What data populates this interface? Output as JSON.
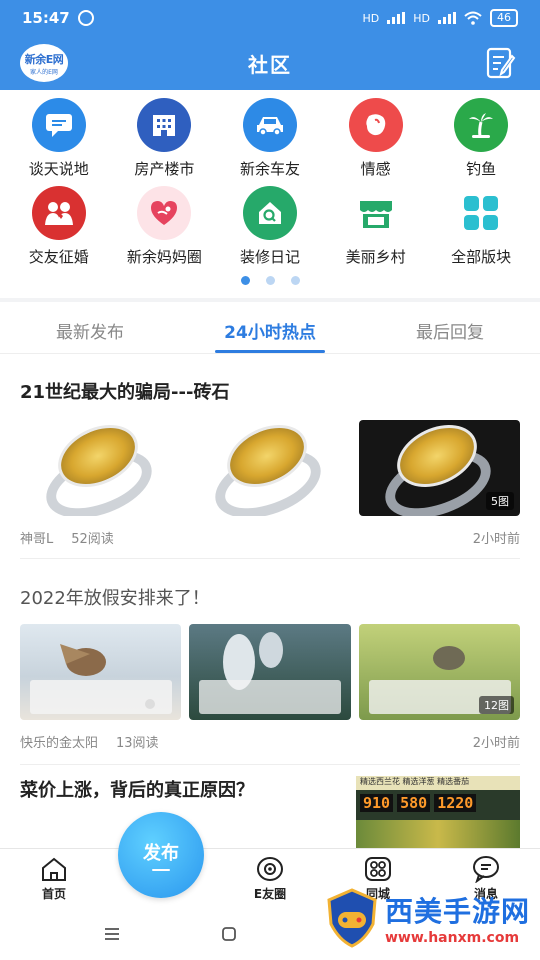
{
  "status_bar": {
    "time": "15:47",
    "battery": "46",
    "signal1": "HD",
    "signal2": "HD"
  },
  "header": {
    "title": "社区",
    "logo_text": "新余E网",
    "logo_sub": "家人的E网"
  },
  "categories_row1": [
    {
      "label": "谈天说地",
      "color": "#2c8be8",
      "icon": "chat-icon"
    },
    {
      "label": "房产楼市",
      "color": "#2f5fbf",
      "icon": "building-icon"
    },
    {
      "label": "新余车友",
      "color": "#2d8ae6",
      "icon": "car-icon"
    },
    {
      "label": "情感",
      "color": "#ee4b4b",
      "icon": "heart-face-icon"
    },
    {
      "label": "钓鱼",
      "color": "#2aa94a",
      "icon": "palm-tree-icon"
    }
  ],
  "categories_row2": [
    {
      "label": "交友征婚",
      "color": "#d93131",
      "icon": "couple-icon"
    },
    {
      "label": "新余妈妈圈",
      "color": "#f49aa8",
      "icon": "mom-heart-icon"
    },
    {
      "label": "装修日记",
      "color": "#26a96a",
      "icon": "house-search-icon"
    },
    {
      "label": "美丽乡村",
      "color": "#26a96a",
      "icon": "village-shop-icon"
    },
    {
      "label": "全部版块",
      "color": "#2bbfd0",
      "icon": "all-sections-icon"
    }
  ],
  "tabs": {
    "latest": "最新发布",
    "hot": "24小时热点",
    "reply": "最后回复"
  },
  "posts": [
    {
      "title": "21世纪最大的骗局---砖石",
      "author": "神哥L",
      "reads": "52阅读",
      "time": "2小时前",
      "image_count": "5图"
    },
    {
      "title": "2022年放假安排来了！",
      "author": "快乐的金太阳",
      "reads": "13阅读",
      "time": "2小时前",
      "image_count": "12图"
    },
    {
      "title": "菜价上涨，背后的真正原因？",
      "price_board": {
        "a": "910",
        "b": "580",
        "c": "1220",
        "header": "精选西兰花 精选洋葱 精选番茄"
      }
    }
  ],
  "bottom_nav": {
    "home": "首页",
    "publish": "发布",
    "ecircle": "E友圈",
    "city": "同城",
    "messages": "消息"
  },
  "watermark": {
    "title": "西美手游网",
    "url": "www.hanxm.com"
  }
}
